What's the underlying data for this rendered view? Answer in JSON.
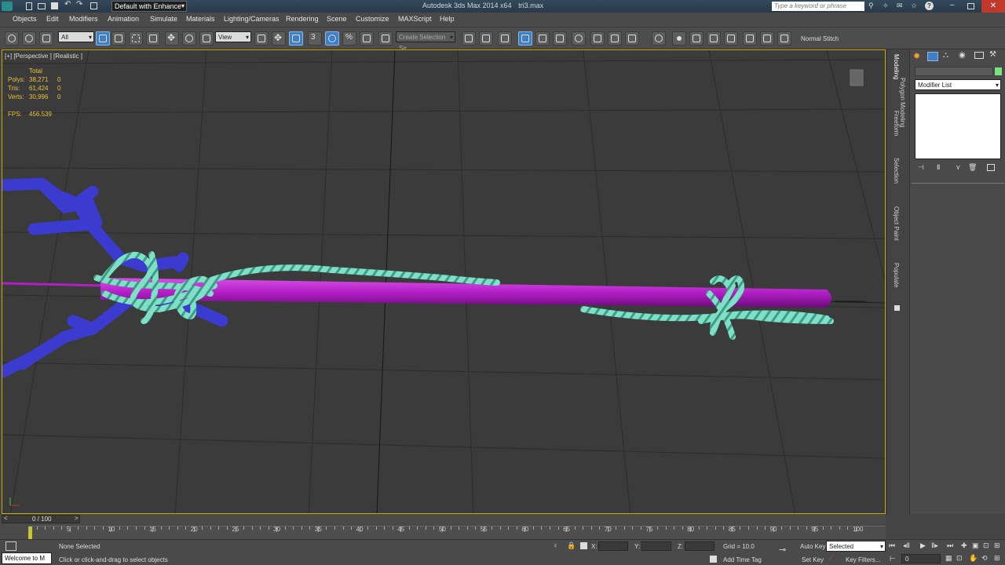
{
  "title_bar": {
    "workspace": "Default with Enhance",
    "app_title": "Autodesk 3ds Max 2014 x64",
    "file_name": "tri3.max",
    "search_placeholder": "Type a keyword or phrase"
  },
  "menu": [
    "Objects",
    "Edit",
    "Modifiers",
    "Animation",
    "Simulate",
    "Materials",
    "Lighting/Cameras",
    "Rendering",
    "Scene",
    "Customize",
    "MAXScript",
    "Help"
  ],
  "toolbar": {
    "filter_value": "All",
    "ref_coord_value": "View",
    "selection_set_placeholder": "Create Selection Se",
    "normal_stitch": "Normal Stitch"
  },
  "viewport": {
    "label": "[+] [Perspective ] [Realistic ]",
    "stats": {
      "header": "Total",
      "polys_label": "Polys:",
      "polys_value": "38,271",
      "polys_sel": "0",
      "tris_label": "Tris:",
      "tris_value": "61,424",
      "tris_sel": "0",
      "verts_label": "Verts:",
      "verts_value": "30,996",
      "verts_sel": "0",
      "fps_label": "FPS:",
      "fps_value": "456.539"
    },
    "colors": {
      "background": "#3b3b3b",
      "rod": "#b21ec6",
      "rope": "#7ee0c6",
      "branch": "#3b3bd0"
    }
  },
  "ribbon_tabs": [
    "Modeling",
    "Polygon Modeling",
    "Freeform",
    "Selection",
    "Object Paint",
    "Populate"
  ],
  "command_panel": {
    "modifier_list": "Modifier List"
  },
  "timeline": {
    "frame_counter": "0 / 100",
    "ticks": [
      "5",
      "10",
      "15",
      "20",
      "25",
      "30",
      "35",
      "40",
      "45",
      "50",
      "55",
      "60",
      "65",
      "70",
      "75",
      "80",
      "85",
      "90",
      "95",
      "100"
    ]
  },
  "status": {
    "listener": "Welcome to M",
    "selection_status": "None Selected",
    "prompt": "Click or click-and-drag to select objects",
    "x_label": "X:",
    "y_label": "Y:",
    "z_label": "Z:",
    "grid": "Grid = 10.0",
    "add_time_tag": "Add Time Tag",
    "auto_key": "Auto Key",
    "set_key": "Set Key",
    "selected_value": "Selected",
    "key_filters": "Key Filters...",
    "frame_value": "0"
  }
}
